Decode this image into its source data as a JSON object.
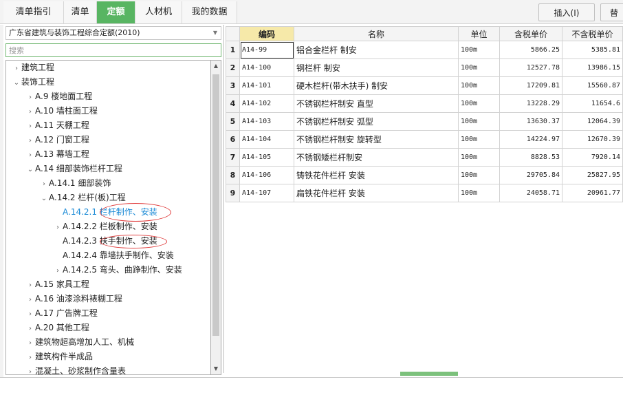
{
  "tabs": [
    {
      "label": "清单指引",
      "active": false
    },
    {
      "label": "清单",
      "active": false
    },
    {
      "label": "定额",
      "active": true
    },
    {
      "label": "人材机",
      "active": false
    },
    {
      "label": "我的数据",
      "active": false
    }
  ],
  "toolbar": {
    "insert_label": "插入(I)",
    "replace_label": "替"
  },
  "left_panel": {
    "dropdown_value": "广东省建筑与装饰工程综合定额(2010)",
    "search_placeholder": "搜索",
    "tree": [
      {
        "label": "建筑工程",
        "level": 0,
        "caret": "right"
      },
      {
        "label": "装饰工程",
        "level": 0,
        "caret": "down"
      },
      {
        "label": "A.9 楼地面工程",
        "level": 1,
        "caret": "right"
      },
      {
        "label": "A.10 墙柱面工程",
        "level": 1,
        "caret": "right"
      },
      {
        "label": "A.11 天棚工程",
        "level": 1,
        "caret": "right"
      },
      {
        "label": "A.12 门窗工程",
        "level": 1,
        "caret": "right"
      },
      {
        "label": "A.13 幕墙工程",
        "level": 1,
        "caret": "right"
      },
      {
        "label": "A.14 细部装饰栏杆工程",
        "level": 1,
        "caret": "down"
      },
      {
        "label": "A.14.1 细部装饰",
        "level": 2,
        "caret": "right"
      },
      {
        "label": "A.14.2 栏杆(板)工程",
        "level": 2,
        "caret": "down"
      },
      {
        "label": "A.14.2.1 栏杆制作、安装",
        "level": 3,
        "caret": "none",
        "selected": true
      },
      {
        "label": "A.14.2.2 栏板制作、安装",
        "level": 3,
        "caret": "right"
      },
      {
        "label": "A.14.2.3 扶手制作、安装",
        "level": 3,
        "caret": "none"
      },
      {
        "label": "A.14.2.4 靠墙扶手制作、安装",
        "level": 3,
        "caret": "none"
      },
      {
        "label": "A.14.2.5 弯头、曲踭制作、安装",
        "level": 3,
        "caret": "right"
      },
      {
        "label": "A.15 家具工程",
        "level": 1,
        "caret": "right"
      },
      {
        "label": "A.16 油漆涂料裱糊工程",
        "level": 1,
        "caret": "right"
      },
      {
        "label": "A.17 广告牌工程",
        "level": 1,
        "caret": "right"
      },
      {
        "label": "A.20 其他工程",
        "level": 1,
        "caret": "right"
      },
      {
        "label": "建筑物超高增加人工、机械",
        "level": 1,
        "caret": "right"
      },
      {
        "label": "建筑构件半成品",
        "level": 1,
        "caret": "right"
      },
      {
        "label": "混凝土、砂浆制作含量表",
        "level": 1,
        "caret": "right"
      }
    ]
  },
  "table": {
    "headers": [
      "编码",
      "名称",
      "单位",
      "含税单价",
      "不含税单价"
    ],
    "rows": [
      {
        "n": "1",
        "code": "A14-99",
        "name": "铝合金栏杆 制安",
        "unit": "100m",
        "tax": "5866.25",
        "notax": "5385.81"
      },
      {
        "n": "2",
        "code": "A14-100",
        "name": "钢栏杆 制安",
        "unit": "100m",
        "tax": "12527.78",
        "notax": "13986.15"
      },
      {
        "n": "3",
        "code": "A14-101",
        "name": "硬木栏杆(带木扶手) 制安",
        "unit": "100m",
        "tax": "17209.81",
        "notax": "15560.87"
      },
      {
        "n": "4",
        "code": "A14-102",
        "name": "不锈钢栏杆制安 直型",
        "unit": "100m",
        "tax": "13228.29",
        "notax": "11654.6"
      },
      {
        "n": "5",
        "code": "A14-103",
        "name": "不锈钢栏杆制安 弧型",
        "unit": "100m",
        "tax": "13630.37",
        "notax": "12064.39"
      },
      {
        "n": "6",
        "code": "A14-104",
        "name": "不锈钢栏杆制安 旋转型",
        "unit": "100m",
        "tax": "14224.97",
        "notax": "12670.39"
      },
      {
        "n": "7",
        "code": "A14-105",
        "name": "不锈钢矮栏杆制安",
        "unit": "100m",
        "tax": "8828.53",
        "notax": "7920.14"
      },
      {
        "n": "8",
        "code": "A14-106",
        "name": "铸铁花件栏杆 安装",
        "unit": "100m",
        "tax": "29705.84",
        "notax": "25827.95"
      },
      {
        "n": "9",
        "code": "A14-107",
        "name": "扁铁花件栏杆 安装",
        "unit": "100m",
        "tax": "24058.71",
        "notax": "20961.77"
      }
    ]
  },
  "colors": {
    "accent": "#58b562",
    "selected_text": "#1a8ad6",
    "annotation": "#e03a3a",
    "code_header": "#f6e9a9"
  }
}
